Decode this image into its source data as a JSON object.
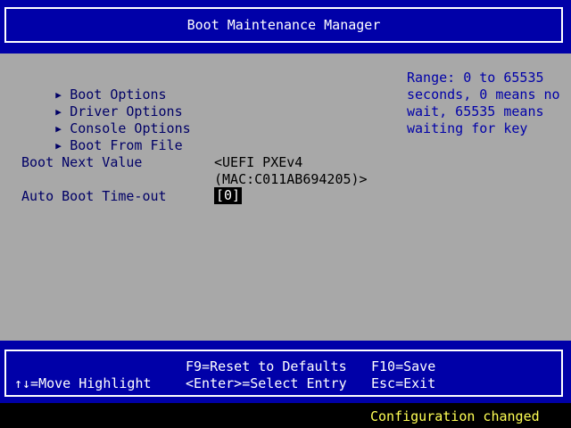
{
  "header": {
    "title": "Boot Maintenance Manager"
  },
  "menu": {
    "items": [
      {
        "label": "Boot Options"
      },
      {
        "label": "Driver Options"
      },
      {
        "label": "Console Options"
      },
      {
        "label": "Boot From File"
      }
    ]
  },
  "fields": {
    "boot_next": {
      "label": "Boot Next Value",
      "value_line1": "<UEFI PXEv4",
      "value_line2": "(MAC:C011AB694205)>"
    },
    "timeout": {
      "label": "Auto Boot Time-out",
      "value": "[0]"
    }
  },
  "help": {
    "lines": [
      "Range: 0 to 65535",
      "seconds, 0 means no",
      "wait, 65535 means",
      "waiting for key"
    ]
  },
  "footer": {
    "move": "↑↓=Move Highlight",
    "reset": "F9=Reset to Defaults",
    "select": "<Enter>=Select Entry",
    "save": "F10=Save",
    "exit": "Esc=Exit"
  },
  "status": {
    "text": "Configuration changed"
  },
  "colors": {
    "background": "#a8a8a8",
    "band": "#0000a8",
    "menu_text": "#000066",
    "help_text": "#0000a8",
    "status_text": "#ffff54"
  }
}
